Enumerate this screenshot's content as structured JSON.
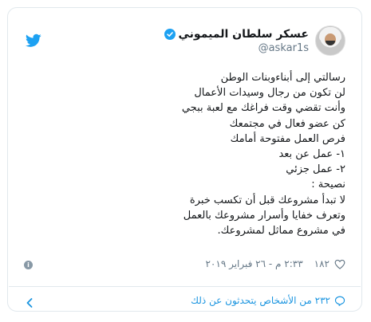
{
  "tweet": {
    "author_name": "عسكر سلطان الميموني",
    "handle": "@askar1s",
    "lines": [
      "رسالتي إلى أبناءوبنات الوطن",
      "لن تكون من رجال وسيدات الأعمال",
      "وأنت تقضي وقت فراغك مع لعبة ببجي",
      "كن عضو فعال في مجتمعك",
      "فرص العمل مفتوحة أمامك",
      "١- عمل عن بعد",
      "٢- عمل جزئي",
      "نصيحة :",
      "لا تبدأ مشروعك قبل أن تكسب خبرة",
      "وتعرف خفايا وأسرار مشروعك بالعمل",
      "في مشروع مماثل لمشروعك."
    ],
    "likes": "١٨٢",
    "timestamp": "٢:٣٣ م - ٢٦ فبراير ٢٠١٩",
    "people_talking": "٢٣٢ من الأشخاص يتحدثون عن ذلك"
  },
  "colors": {
    "brand_blue": "#1da1f2",
    "link_blue": "#1b95e0",
    "muted": "#657786",
    "border": "#e1e8ed"
  },
  "icons": {
    "brand": "twitter-bird-icon",
    "verified": "verified-badge-icon",
    "like": "heart-icon",
    "info": "info-icon",
    "reply": "speech-bubble-icon",
    "back": "chevron-left-icon"
  }
}
